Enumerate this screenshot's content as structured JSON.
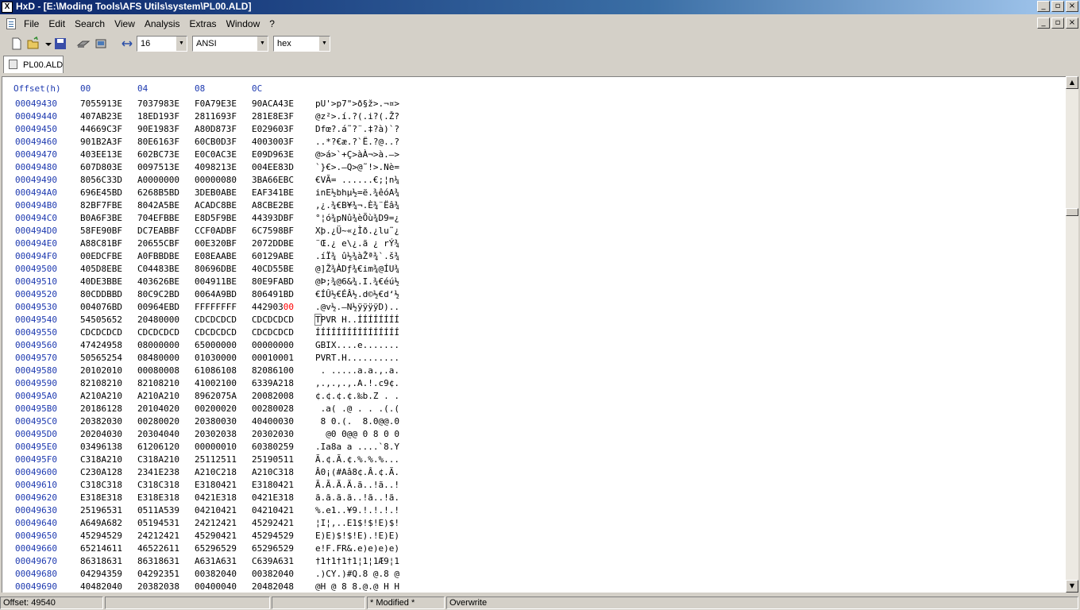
{
  "window": {
    "title": "HxD - [E:\\Moding Tools\\AFS Utils\\system\\PL00.ALD]",
    "controls": [
      "_",
      "▫",
      "×"
    ]
  },
  "menu": {
    "items": [
      "File",
      "Edit",
      "Search",
      "View",
      "Analysis",
      "Extras",
      "Window",
      "?"
    ]
  },
  "toolbar": {
    "bytes_per_row": "16",
    "charset": "ANSI",
    "offset_base": "hex"
  },
  "tab": {
    "label": "PL00.ALD"
  },
  "header": {
    "offset": "Offset(h)",
    "columns": [
      "00",
      "04",
      "08",
      "0C"
    ]
  },
  "rows": [
    {
      "offset": "00049430",
      "hex": [
        "7055913E",
        "7037983E",
        "F0A79E3E",
        "90ACA43E"
      ],
      "text": "pU'>p7\">ð§ž>.¬¤>"
    },
    {
      "offset": "00049440",
      "hex": [
        "407AB23E",
        "18ED193F",
        "2811693F",
        "281E8E3F"
      ],
      "text": "@z²>.í.?(.i?(.Ž?"
    },
    {
      "offset": "00049450",
      "hex": [
        "44669C3F",
        "90E1983F",
        "A80D873F",
        "E029603F"
      ],
      "text": "Dfœ?.á˜?¨.‡?à)`?"
    },
    {
      "offset": "00049460",
      "hex": [
        "901B2A3F",
        "80E6163F",
        "60CB0D3F",
        "4003003F"
      ],
      "text": "..*?€æ.?`Ë.?@..?"
    },
    {
      "offset": "00049470",
      "hex": [
        "403EE13E",
        "602BC73E",
        "E0C0AC3E",
        "E09D963E"
      ],
      "text": "@>á>`+Ç>àÀ¬>à.–>"
    },
    {
      "offset": "00049480",
      "hex": [
        "607D803E",
        "0097513E",
        "4098213E",
        "004EE83D"
      ],
      "text": "`}€>.—Q>@˜!>.Nè="
    },
    {
      "offset": "00049490",
      "hex": [
        "8056C33D",
        "A0000000",
        "00000080",
        "3BA66EBC"
      ],
      "text": "€VÃ= ......€;¦n¼"
    },
    {
      "offset": "000494A0",
      "hex": [
        "696E45BD",
        "6268B5BD",
        "3DEB0ABE",
        "EAF341BE"
      ],
      "text": "inE½bhµ½=ë.¾êóA¾"
    },
    {
      "offset": "000494B0",
      "hex": [
        "82BF7FBE",
        "8042A5BE",
        "ACADC8BE",
        "A8CBE2BE"
      ],
      "text": "‚¿.¾€B¥¾¬.È¾¨Ëâ¾"
    },
    {
      "offset": "000494C0",
      "hex": [
        "B0A6F3BE",
        "704EFBBE",
        "E8D5F9BE",
        "44393DBF"
      ],
      "text": "°¦ó¾pNû¾èÕù¾D9=¿"
    },
    {
      "offset": "000494D0",
      "hex": [
        "58FE90BF",
        "DC7EABBF",
        "CCF0ADBF",
        "6C7598BF"
      ],
      "text": "Xþ.¿Ü~«¿Ìð.¿lu˜¿"
    },
    {
      "offset": "000494E0",
      "hex": [
        "A88C81BF",
        "20655CBF",
        "00E320BF",
        "2072DDBE"
      ],
      "text": "¨Œ.¿ e\\¿.ã ¿ rÝ¾"
    },
    {
      "offset": "000494F0",
      "hex": [
        "00EDCFBE",
        "A0FBBDBE",
        "E08EAABE",
        "60129ABE"
      ],
      "text": ".íÏ¾ û½¾àŽª¾`.š¾"
    },
    {
      "offset": "00049500",
      "hex": [
        "405D8EBE",
        "C04483BE",
        "80696DBE",
        "40CD55BE"
      ],
      "text": "@]Ž¾ÀDƒ¾€im¾@ÍU¾"
    },
    {
      "offset": "00049510",
      "hex": [
        "40DE3BBE",
        "403626BE",
        "004911BE",
        "80E9FABD"
      ],
      "text": "@Þ;¾@6&¾.I.¾€éú½"
    },
    {
      "offset": "00049520",
      "hex": [
        "80CDDBBD",
        "80C9C2BD",
        "0064A9BD",
        "806491BD"
      ],
      "text": "€ÍÛ½€ÉÂ½.d©½€d‘½"
    },
    {
      "offset": "00049530",
      "hex": [
        "004076BD",
        "00964EBD",
        "FFFFFFFF",
        "44290300"
      ],
      "text": ".@v½.–N½ÿÿÿÿD)..",
      "red": true
    },
    {
      "offset": "00049540",
      "hex": [
        "54505652",
        "20480000",
        "CDCDCDCD",
        "CDCDCDCD"
      ],
      "text": "TPVR H..ÍÍÍÍÍÍÍÍ",
      "caret": true
    },
    {
      "offset": "00049550",
      "hex": [
        "CDCDCDCD",
        "CDCDCDCD",
        "CDCDCDCD",
        "CDCDCDCD"
      ],
      "text": "ÍÍÍÍÍÍÍÍÍÍÍÍÍÍÍÍ"
    },
    {
      "offset": "00049560",
      "hex": [
        "47424958",
        "08000000",
        "65000000",
        "00000000"
      ],
      "text": "GBIX....e......."
    },
    {
      "offset": "00049570",
      "hex": [
        "50565254",
        "08480000",
        "01030000",
        "00010001"
      ],
      "text": "PVRT.H.........."
    },
    {
      "offset": "00049580",
      "hex": [
        "20102010",
        "00080008",
        "61086108",
        "82086100"
      ],
      "text": " . .....a.a.‚.a."
    },
    {
      "offset": "00049590",
      "hex": [
        "82108210",
        "82108210",
        "41002100",
        "6339A218"
      ],
      "text": "‚.‚.‚.‚.A.!.c9¢."
    },
    {
      "offset": "000495A0",
      "hex": [
        "A210A210",
        "A210A210",
        "8962075A",
        "20082008"
      ],
      "text": "¢.¢.¢.¢.‰b.Z . ."
    },
    {
      "offset": "000495B0",
      "hex": [
        "20186128",
        "20104020",
        "00200020",
        "00280028"
      ],
      "text": " .a( .@ . . .(.("
    },
    {
      "offset": "000495C0",
      "hex": [
        "20382030",
        "00280020",
        "20380030",
        "40400030"
      ],
      "text": " 8 0.(.  8.0@@.0"
    },
    {
      "offset": "000495D0",
      "hex": [
        "20204030",
        "20304040",
        "20302038",
        "20302030"
      ],
      "text": "  @0 0@@ 0 8 0 0"
    },
    {
      "offset": "000495E0",
      "hex": [
        "03496138",
        "61206120",
        "00000010",
        "60380259"
      ],
      "text": ".Ia8a a ....`8.Y"
    },
    {
      "offset": "000495F0",
      "hex": [
        "C318A210",
        "C318A210",
        "25112511",
        "25190511"
      ],
      "text": "Ã.¢.Ã.¢.%.%.%..."
    },
    {
      "offset": "00049600",
      "hex": [
        "C230A128",
        "2341E238",
        "A210C218",
        "A210C318"
      ],
      "text": "Â0¡(#Aâ8¢.Â.¢.Ã."
    },
    {
      "offset": "00049610",
      "hex": [
        "C318C318",
        "C318C318",
        "E3180421",
        "E3180421"
      ],
      "text": "Ã.Ã.Ã.Ã.ã..!ã..!"
    },
    {
      "offset": "00049620",
      "hex": [
        "E318E318",
        "E318E318",
        "0421E318",
        "0421E318"
      ],
      "text": "ã.ã.ã.ã..!ã..!ã."
    },
    {
      "offset": "00049630",
      "hex": [
        "25196531",
        "0511A539",
        "04210421",
        "04210421"
      ],
      "text": "%.e1..¥9.!.!.!.!"
    },
    {
      "offset": "00049640",
      "hex": [
        "A649A682",
        "05194531",
        "24212421",
        "45292421"
      ],
      "text": "¦I¦‚..E1$!$!E)$!"
    },
    {
      "offset": "00049650",
      "hex": [
        "45294529",
        "24212421",
        "45290421",
        "45294529"
      ],
      "text": "E)E)$!$!E).!E)E)"
    },
    {
      "offset": "00049660",
      "hex": [
        "65214611",
        "46522611",
        "65296529",
        "65296529"
      ],
      "text": "e!F.FR&.e)e)e)e)"
    },
    {
      "offset": "00049670",
      "hex": [
        "86318631",
        "86318631",
        "A631A631",
        "C639A631"
      ],
      "text": "†1†1†1†1¦1¦1Æ9¦1"
    },
    {
      "offset": "00049680",
      "hex": [
        "04294359",
        "04292351",
        "00382040",
        "00382040"
      ],
      "text": ".)CY.)#Q.8 @.8 @"
    },
    {
      "offset": "00049690",
      "hex": [
        "40482040",
        "20382038",
        "00400040",
        "20482048"
      ],
      "text": "@H @ 8 8.@.@ H H"
    }
  ],
  "status": {
    "offset": "Offset: 49540",
    "modified": "* Modified *",
    "mode": "Overwrite"
  }
}
